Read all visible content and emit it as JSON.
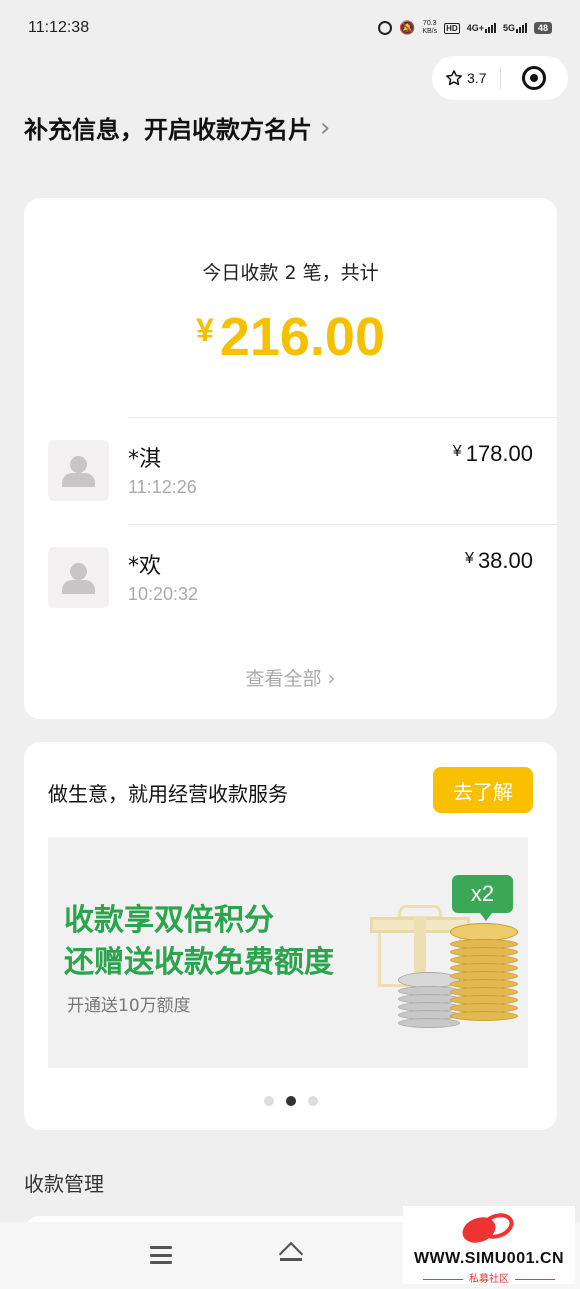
{
  "status_bar": {
    "time": "11:12:38",
    "speed_value": "70.3",
    "speed_unit": "KB/s",
    "hd_label": "HD",
    "net1": "4G+",
    "net2": "5G",
    "battery": "48"
  },
  "capsule": {
    "rating": "3.7",
    "star_icon": "star-outline-icon",
    "target_icon": "target-icon"
  },
  "header": {
    "link_text": "补充信息，开启收款方名片"
  },
  "summary": {
    "label": "今日收款 2 笔，共计",
    "currency": "¥",
    "total": "216.00",
    "accent_color": "#f5c000",
    "transactions": [
      {
        "name": "*淇",
        "time": "11:12:26",
        "currency": "¥",
        "amount": "178.00"
      },
      {
        "name": "*欢",
        "time": "10:20:32",
        "currency": "¥",
        "amount": "38.00"
      }
    ],
    "view_all": "查看全部"
  },
  "promo": {
    "title": "做生意，就用经营收款服务",
    "button": "去了解",
    "button_color": "#fac000",
    "banner": {
      "line1": "收款享双倍积分",
      "line2": "还赠送收款免费额度",
      "sub": "开通送10万额度",
      "badge": "x2",
      "accent_color": "#2ba44d"
    },
    "pages": 3,
    "active_page": 2
  },
  "section": {
    "title": "收款管理"
  },
  "watermark": {
    "site": "WWW.SIMU001.CN",
    "label": "私募社区"
  }
}
